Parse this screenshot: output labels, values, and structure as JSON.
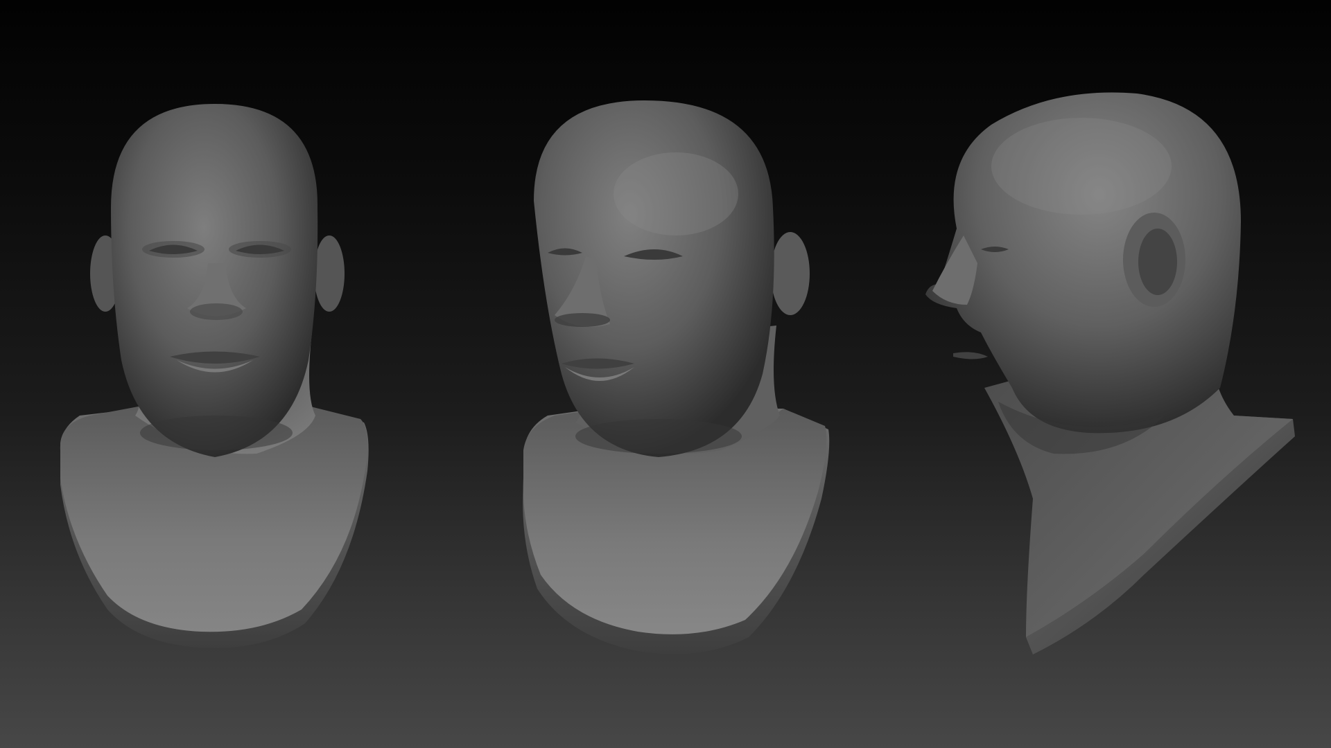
{
  "scene": {
    "background_top": "#020202",
    "background_bottom": "#474747",
    "material_color": "#6a6a6a",
    "views": [
      {
        "name": "front",
        "icon": "bust-front-view"
      },
      {
        "name": "three-quarter",
        "icon": "bust-three-quarter-view"
      },
      {
        "name": "side",
        "icon": "bust-side-view"
      }
    ]
  }
}
